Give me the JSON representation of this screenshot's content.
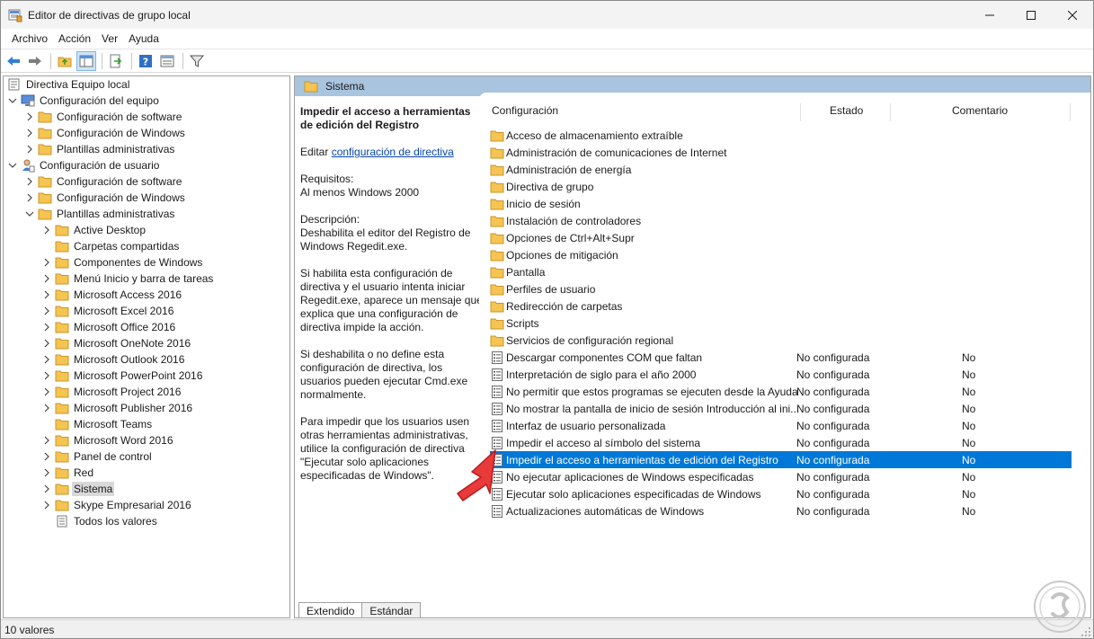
{
  "window": {
    "title": "Editor de directivas de grupo local"
  },
  "menubar": [
    "Archivo",
    "Acción",
    "Ver",
    "Ayuda"
  ],
  "tree": {
    "items": [
      {
        "label": "Directiva Equipo local",
        "level": 0,
        "icon": "computer-policy-icon",
        "expander": "none"
      },
      {
        "label": "Configuración del equipo",
        "level": 1,
        "icon": "computer-icon",
        "expander": "expanded"
      },
      {
        "label": "Configuración de software",
        "level": 2,
        "icon": "folder-icon",
        "expander": "collapsed"
      },
      {
        "label": "Configuración de Windows",
        "level": 2,
        "icon": "folder-icon",
        "expander": "collapsed"
      },
      {
        "label": "Plantillas administrativas",
        "level": 2,
        "icon": "folder-icon",
        "expander": "collapsed"
      },
      {
        "label": "Configuración de usuario",
        "level": 1,
        "icon": "user-icon",
        "expander": "expanded"
      },
      {
        "label": "Configuración de software",
        "level": 2,
        "icon": "folder-icon",
        "expander": "collapsed"
      },
      {
        "label": "Configuración de Windows",
        "level": 2,
        "icon": "folder-icon",
        "expander": "collapsed"
      },
      {
        "label": "Plantillas administrativas",
        "level": 2,
        "icon": "folder-icon",
        "expander": "expanded"
      },
      {
        "label": "Active Desktop",
        "level": 3,
        "icon": "folder-icon",
        "expander": "collapsed"
      },
      {
        "label": "Carpetas compartidas",
        "level": 3,
        "icon": "folder-icon",
        "expander": "none"
      },
      {
        "label": "Componentes de Windows",
        "level": 3,
        "icon": "folder-icon",
        "expander": "collapsed"
      },
      {
        "label": "Menú Inicio y barra de tareas",
        "level": 3,
        "icon": "folder-icon",
        "expander": "collapsed"
      },
      {
        "label": "Microsoft Access 2016",
        "level": 3,
        "icon": "folder-icon",
        "expander": "collapsed"
      },
      {
        "label": "Microsoft Excel 2016",
        "level": 3,
        "icon": "folder-icon",
        "expander": "collapsed"
      },
      {
        "label": "Microsoft Office 2016",
        "level": 3,
        "icon": "folder-icon",
        "expander": "collapsed"
      },
      {
        "label": "Microsoft OneNote 2016",
        "level": 3,
        "icon": "folder-icon",
        "expander": "collapsed"
      },
      {
        "label": "Microsoft Outlook 2016",
        "level": 3,
        "icon": "folder-icon",
        "expander": "collapsed"
      },
      {
        "label": "Microsoft PowerPoint 2016",
        "level": 3,
        "icon": "folder-icon",
        "expander": "collapsed"
      },
      {
        "label": "Microsoft Project 2016",
        "level": 3,
        "icon": "folder-icon",
        "expander": "collapsed"
      },
      {
        "label": "Microsoft Publisher 2016",
        "level": 3,
        "icon": "folder-icon",
        "expander": "collapsed"
      },
      {
        "label": "Microsoft Teams",
        "level": 3,
        "icon": "folder-icon",
        "expander": "none"
      },
      {
        "label": "Microsoft Word 2016",
        "level": 3,
        "icon": "folder-icon",
        "expander": "collapsed"
      },
      {
        "label": "Panel de control",
        "level": 3,
        "icon": "folder-icon",
        "expander": "collapsed"
      },
      {
        "label": "Red",
        "level": 3,
        "icon": "folder-icon",
        "expander": "collapsed"
      },
      {
        "label": "Sistema",
        "level": 3,
        "icon": "folder-icon",
        "expander": "collapsed",
        "selected": true
      },
      {
        "label": "Skype Empresarial 2016",
        "level": 3,
        "icon": "folder-icon",
        "expander": "collapsed"
      },
      {
        "label": "Todos los valores",
        "level": 3,
        "icon": "all-settings-icon",
        "expander": "none"
      }
    ]
  },
  "right": {
    "header": "Sistema",
    "description": {
      "title": "Impedir el acceso a herramientas de edición del Registro",
      "edit_prefix": "Editar ",
      "edit_link": "configuración de directiva",
      "requirements_label": "Requisitos:",
      "requirements_value": "Al menos Windows 2000",
      "description_label": "Descripción:",
      "description_value": "Deshabilita el editor del Registro de Windows Regedit.exe.",
      "p1": "Si habilita esta configuración de directiva y el usuario intenta iniciar Regedit.exe, aparece un mensaje que explica que una configuración de directiva impide la acción.",
      "p2": "Si deshabilita o no define esta configuración de directiva, los usuarios pueden ejecutar Cmd.exe normalmente.",
      "p3": "Para impedir que los usuarios usen otras herramientas administrativas, utilice la configuración de directiva \"Ejecutar solo aplicaciones especificadas de Windows\"."
    },
    "columns": {
      "name": "Configuración",
      "state": "Estado",
      "comment": "Comentario"
    },
    "rows": [
      {
        "name": "Acceso de almacenamiento extraíble",
        "state": "",
        "comment": "",
        "icon": "folder-icon"
      },
      {
        "name": "Administración de comunicaciones de Internet",
        "state": "",
        "comment": "",
        "icon": "folder-icon"
      },
      {
        "name": "Administración de energía",
        "state": "",
        "comment": "",
        "icon": "folder-icon"
      },
      {
        "name": "Directiva de grupo",
        "state": "",
        "comment": "",
        "icon": "folder-icon"
      },
      {
        "name": "Inicio de sesión",
        "state": "",
        "comment": "",
        "icon": "folder-icon"
      },
      {
        "name": "Instalación de controladores",
        "state": "",
        "comment": "",
        "icon": "folder-icon"
      },
      {
        "name": "Opciones de Ctrl+Alt+Supr",
        "state": "",
        "comment": "",
        "icon": "folder-icon"
      },
      {
        "name": "Opciones de mitigación",
        "state": "",
        "comment": "",
        "icon": "folder-icon"
      },
      {
        "name": "Pantalla",
        "state": "",
        "comment": "",
        "icon": "folder-icon"
      },
      {
        "name": "Perfiles de usuario",
        "state": "",
        "comment": "",
        "icon": "folder-icon"
      },
      {
        "name": "Redirección de carpetas",
        "state": "",
        "comment": "",
        "icon": "folder-icon"
      },
      {
        "name": "Scripts",
        "state": "",
        "comment": "",
        "icon": "folder-icon"
      },
      {
        "name": "Servicios de configuración regional",
        "state": "",
        "comment": "",
        "icon": "folder-icon"
      },
      {
        "name": "Descargar componentes COM que faltan",
        "state": "No configurada",
        "comment": "No",
        "icon": "policy-setting-icon"
      },
      {
        "name": "Interpretación de siglo para el año 2000",
        "state": "No configurada",
        "comment": "No",
        "icon": "policy-setting-icon"
      },
      {
        "name": "No permitir que estos programas se ejecuten desde la Ayuda",
        "state": "No configurada",
        "comment": "No",
        "icon": "policy-setting-icon"
      },
      {
        "name": "No mostrar la pantalla de inicio de sesión Introducción al ini...",
        "state": "No configurada",
        "comment": "No",
        "icon": "policy-setting-icon"
      },
      {
        "name": "Interfaz de usuario personalizada",
        "state": "No configurada",
        "comment": "No",
        "icon": "policy-setting-icon"
      },
      {
        "name": "Impedir el acceso al símbolo del sistema",
        "state": "No configurada",
        "comment": "No",
        "icon": "policy-setting-icon"
      },
      {
        "name": "Impedir el acceso a herramientas de edición del Registro",
        "state": "No configurada",
        "comment": "No",
        "icon": "policy-setting-icon",
        "selected": true
      },
      {
        "name": "No ejecutar aplicaciones de Windows especificadas",
        "state": "No configurada",
        "comment": "No",
        "icon": "policy-setting-icon"
      },
      {
        "name": "Ejecutar solo aplicaciones especificadas de Windows",
        "state": "No configurada",
        "comment": "No",
        "icon": "policy-setting-icon"
      },
      {
        "name": "Actualizaciones automáticas de Windows",
        "state": "No configurada",
        "comment": "No",
        "icon": "policy-setting-icon"
      }
    ],
    "tabs": [
      "Extendido",
      "Estándar"
    ]
  },
  "statusbar": {
    "text": "10 valores"
  },
  "colors": {
    "selection": "#0078d7",
    "header_band": "#a8c4df",
    "folder": "#f5c451",
    "annotation_arrow": "#e8393b"
  }
}
